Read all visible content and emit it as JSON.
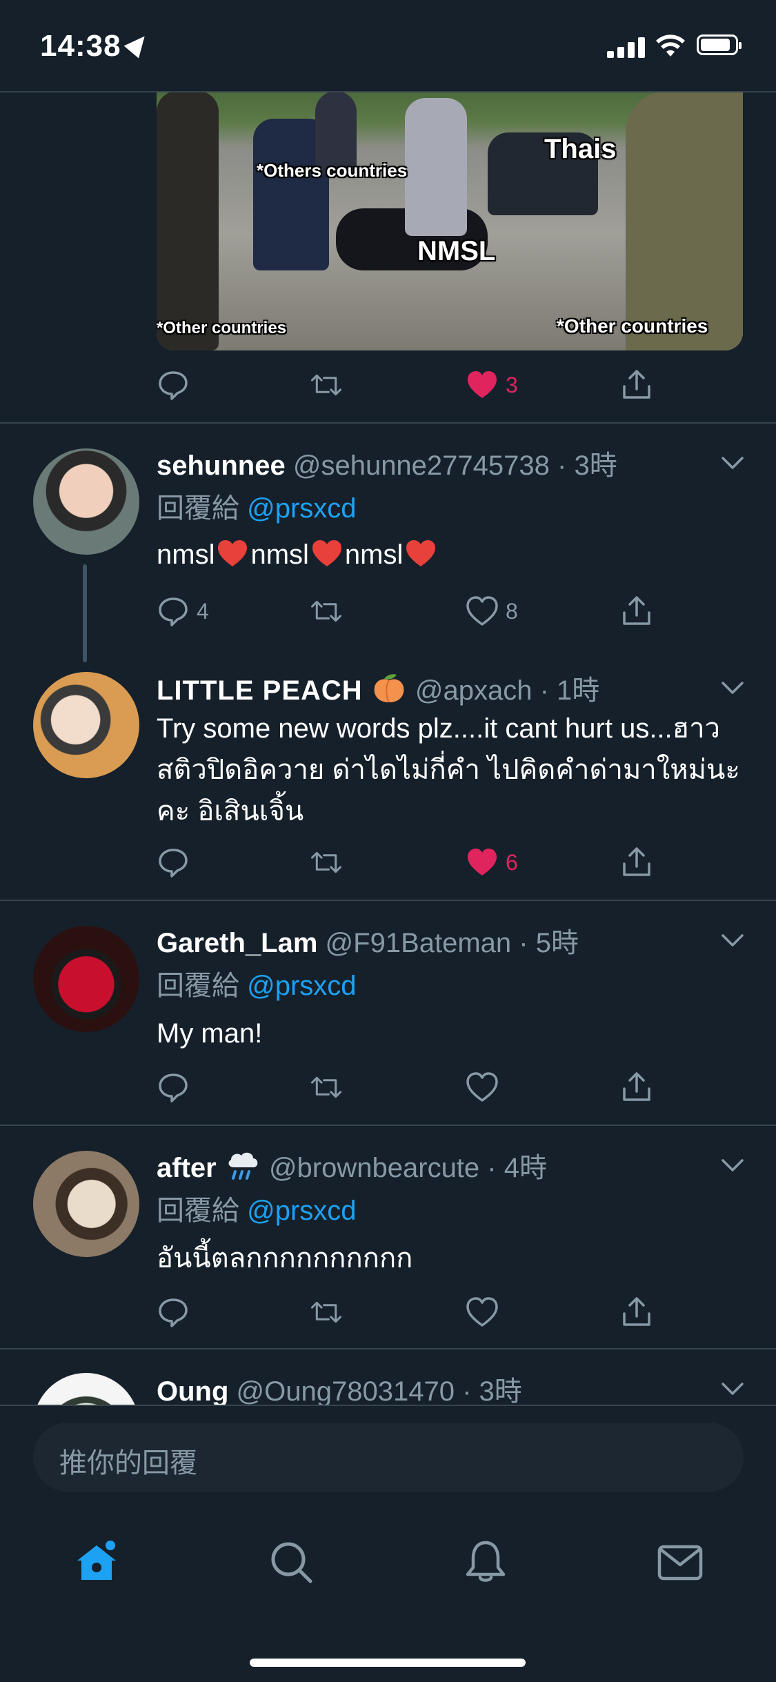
{
  "status_bar": {
    "time": "14:38"
  },
  "meme": {
    "captions": [
      "*Others countries",
      "Thais",
      "NMSL",
      "*Other countries",
      "*Other countries"
    ]
  },
  "top_tweet_actions": {
    "like_count": "3"
  },
  "tweets": [
    {
      "name": "sehunnee",
      "handle": "@sehunne27745738 · 3時",
      "reply_prefix": "回覆給",
      "reply_to": "@prsxcd",
      "text_parts": [
        "nmsl",
        "nmsl",
        "nmsl"
      ],
      "reply_count": "4",
      "like_count": "8"
    },
    {
      "name": "LITTLE PEACH",
      "handle": "@apxach · 1時",
      "text": "Try some new words plz....it cant hurt us...ฮาวสติวปิดอิควาย ด่าไดไม่กี่คำ ไปคิดคำด่ามาใหม่นะคะ อิเสินเจิ้น",
      "like_count": "6"
    },
    {
      "name": "Gareth_Lam",
      "handle": "@F91Bateman · 5時",
      "reply_prefix": "回覆給",
      "reply_to": "@prsxcd",
      "text": "My man!"
    },
    {
      "name": "after",
      "handle": "@brownbearcute · 4時",
      "reply_prefix": "回覆給",
      "reply_to": "@prsxcd",
      "text": "อันนี้ตลกกกกกกกกกก"
    },
    {
      "name": "Oung",
      "handle": "@Oung78031470 · 3時"
    }
  ],
  "reply_box": {
    "placeholder": "推你的回覆"
  },
  "tab_bar": {
    "items": [
      "home-icon",
      "search-icon",
      "bell-icon",
      "mail-icon"
    ]
  },
  "colors": {
    "accent": "#1da1f2",
    "like": "#e0245e",
    "background": "#15202b",
    "muted": "#8899a6"
  }
}
